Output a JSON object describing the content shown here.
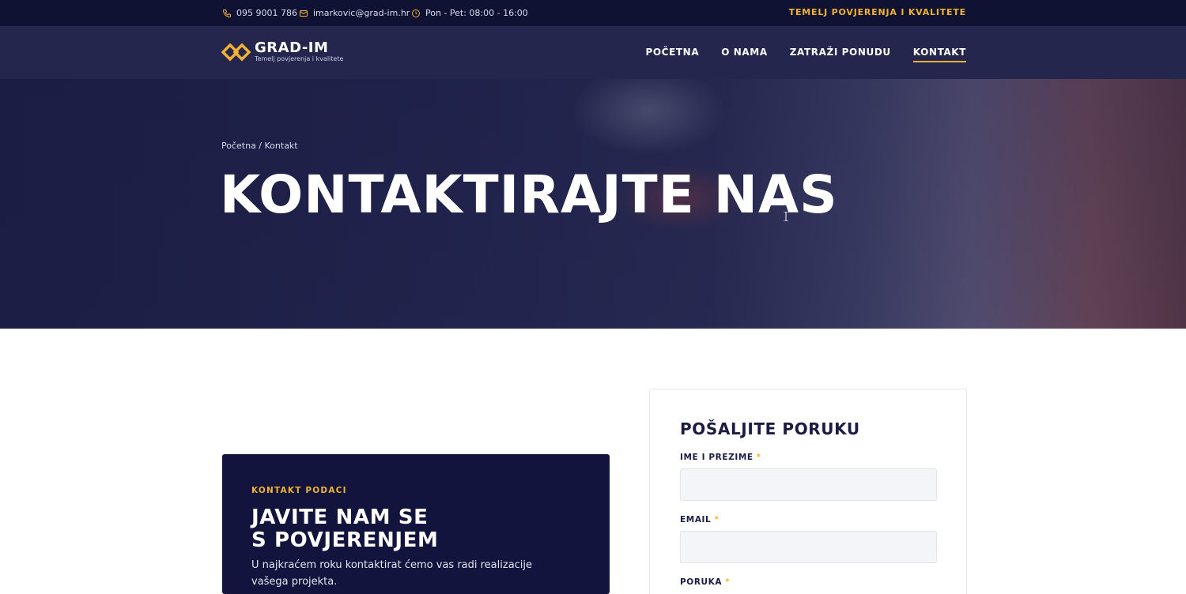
{
  "topbar": {
    "phone": "095 9001 786",
    "email": "imarkovic@grad-im.hr",
    "hours": "Pon - Pet: 08:00 - 16:00",
    "tagline": "TEMELJ POVJERENJA I KVALITETE",
    "icons": [
      "phone-icon",
      "mail-icon",
      "clock-icon"
    ],
    "accent": "#f2b232"
  },
  "nav": {
    "logo_name": "GRAD-IM",
    "logo_sub": "Temelj povjerenja i kvalitete",
    "items": [
      {
        "label": "POČETNA",
        "active": false
      },
      {
        "label": "O NAMA",
        "active": false
      },
      {
        "label": "ZATRAŽI PONUDU",
        "active": false
      },
      {
        "label": "KONTAKT",
        "active": true
      }
    ]
  },
  "hero": {
    "breadcrumb": "Početna / Kontakt",
    "title": "KONTAKTIRAJTE NAS"
  },
  "contact": {
    "eyebrow": "KONTAKT PODACI",
    "heading_line1": "JAVITE NAM SE",
    "heading_line2": "S POVJERENJEM",
    "description": "U najkraćem roku kontaktirat ćemo vas radi realizacije vašega projekta."
  },
  "form": {
    "title": "POŠALJITE PORUKU",
    "fields": [
      {
        "label": "IME I PREZIME",
        "required": "*",
        "value": ""
      },
      {
        "label": "EMAIL",
        "required": "*",
        "value": ""
      },
      {
        "label": "PORUKA",
        "required": "*",
        "value": ""
      }
    ]
  },
  "colors": {
    "navy_dark": "#0f1233",
    "navy": "#24264d",
    "card": "#12143d",
    "gold": "#f2b232"
  }
}
